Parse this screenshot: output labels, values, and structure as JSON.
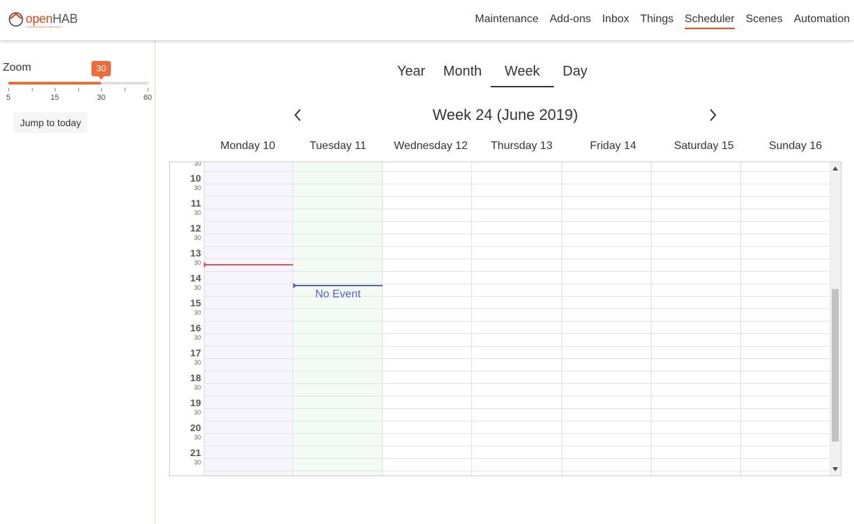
{
  "app": {
    "logo_text_a": "open",
    "logo_text_b": "HAB",
    "logo_tagline": "empowering the smart home"
  },
  "nav": {
    "items": [
      "Maintenance",
      "Add-ons",
      "Inbox",
      "Things",
      "Scheduler",
      "Scenes",
      "Automation"
    ],
    "active": "Scheduler",
    "accent_color": "#e64a19"
  },
  "sidebar": {
    "zoom_label": "Zoom",
    "zoom_value": "30",
    "zoom_min": 5,
    "zoom_max": 60,
    "zoom_ticks": [
      "5",
      "15",
      "30",
      "60"
    ],
    "jump_label": "Jump to today",
    "slider_color": "#ef6c39"
  },
  "views": {
    "tabs": [
      "Year",
      "Month",
      "Week",
      "Day"
    ],
    "active": "Week"
  },
  "calendar": {
    "title": "Week 24 (June 2019)",
    "days": [
      "Monday 10",
      "Tuesday 11",
      "Wednesday 12",
      "Thursday 13",
      "Friday 14",
      "Saturday 15",
      "Sunday 16"
    ],
    "hours": [
      "10",
      "11",
      "12",
      "13",
      "14",
      "15",
      "16",
      "17",
      "18",
      "19",
      "20",
      "21"
    ],
    "half_label": "30",
    "monday_tint": "#f6f4fc",
    "today_tint": "#f3fbf5",
    "current_time_color": "#e05555",
    "event_color": "#5b5bd6",
    "event_label": "No Event",
    "current_time": "13:30",
    "event_time": "14:00"
  }
}
